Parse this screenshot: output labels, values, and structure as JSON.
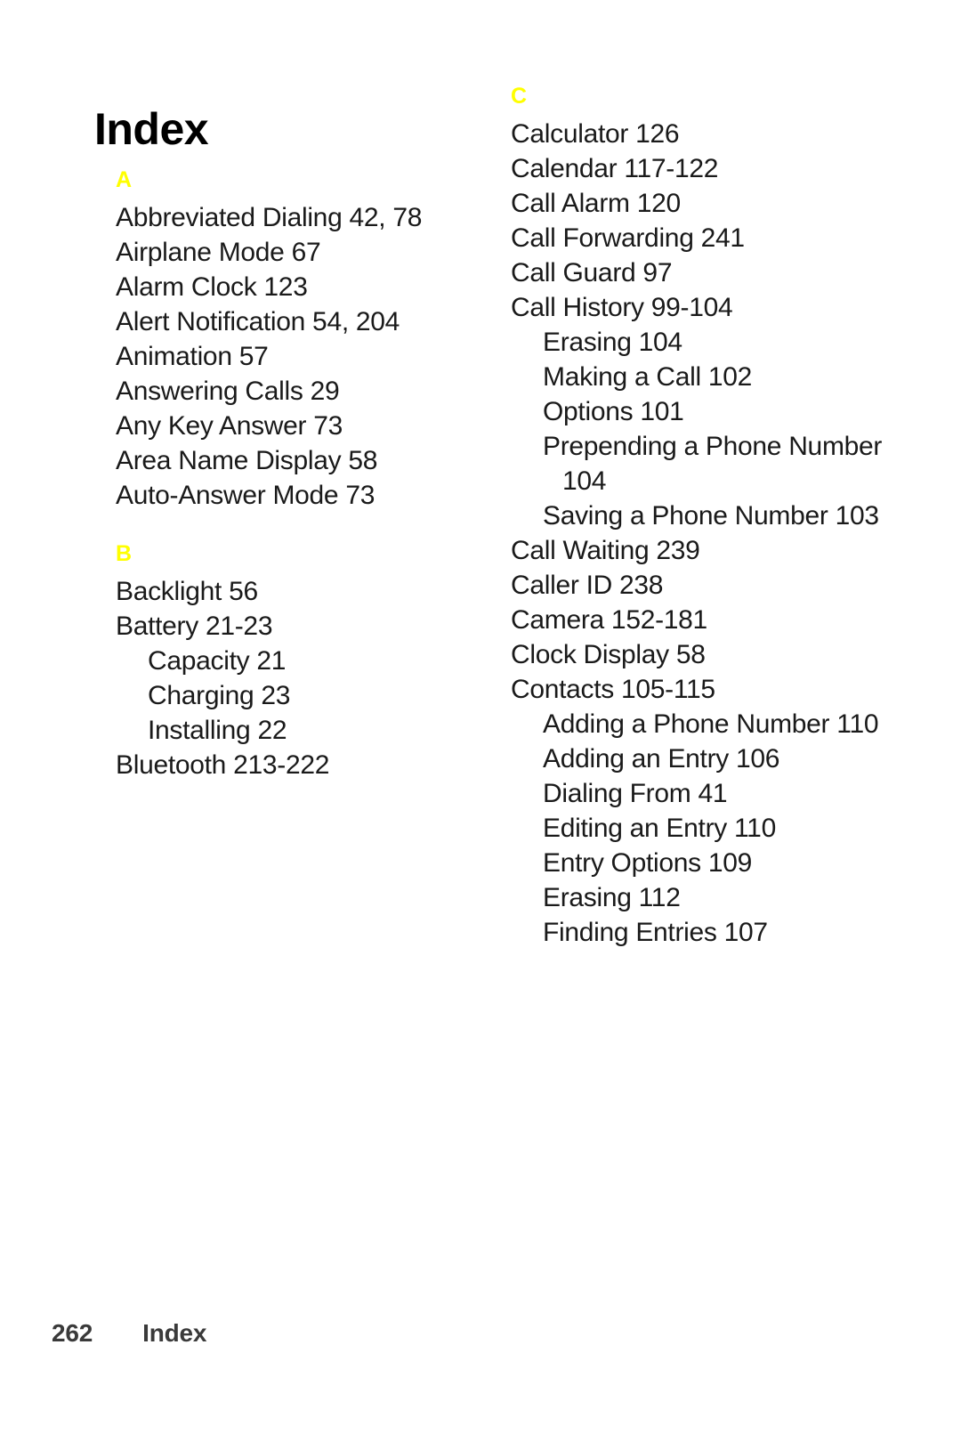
{
  "document": {
    "title": "Index",
    "accent_color": "#ffff00",
    "text_color": "#1a1a1a",
    "footer_color": "#3a3a3a"
  },
  "columns": [
    {
      "name": "left-column",
      "sections": [
        {
          "letter": "A",
          "entries": [
            {
              "text": "Abbreviated Dialing 42, 78",
              "level": 1
            },
            {
              "text": "Airplane Mode 67",
              "level": 1
            },
            {
              "text": "Alarm Clock 123",
              "level": 1
            },
            {
              "text": "Alert Notification 54, 204",
              "level": 1
            },
            {
              "text": "Animation 57",
              "level": 1
            },
            {
              "text": "Answering Calls 29",
              "level": 1
            },
            {
              "text": "Any Key Answer 73",
              "level": 1
            },
            {
              "text": "Area Name Display 58",
              "level": 1
            },
            {
              "text": "Auto-Answer Mode 73",
              "level": 1
            }
          ]
        },
        {
          "letter": "B",
          "entries": [
            {
              "text": "Backlight 56",
              "level": 1
            },
            {
              "text": "Battery 21-23",
              "level": 1
            },
            {
              "text": "Capacity 21",
              "level": 2
            },
            {
              "text": "Charging 23",
              "level": 2
            },
            {
              "text": "Installing 22",
              "level": 2
            },
            {
              "text": "Bluetooth 213-222",
              "level": 1
            }
          ]
        }
      ]
    },
    {
      "name": "right-column",
      "sections": [
        {
          "letter": "C",
          "entries": [
            {
              "text": "Calculator 126",
              "level": 1
            },
            {
              "text": "Calendar 117-122",
              "level": 1
            },
            {
              "text": "Call Alarm 120",
              "level": 1
            },
            {
              "text": "Call Forwarding 241",
              "level": 1
            },
            {
              "text": "Call Guard 97",
              "level": 1
            },
            {
              "text": "Call History 99-104",
              "level": 1
            },
            {
              "text": "Erasing 104",
              "level": 2
            },
            {
              "text": "Making a Call 102",
              "level": 2
            },
            {
              "text": "Options 101",
              "level": 2
            },
            {
              "text": "Prepending a Phone Number 104",
              "level": 2,
              "wrapped": true
            },
            {
              "text": "Saving a Phone Number 103",
              "level": 2,
              "wrapped": true
            },
            {
              "text": "Call Waiting 239",
              "level": 1
            },
            {
              "text": "Caller ID 238",
              "level": 1
            },
            {
              "text": "Camera 152-181",
              "level": 1
            },
            {
              "text": "Clock Display 58",
              "level": 1
            },
            {
              "text": "Contacts 105-115",
              "level": 1
            },
            {
              "text": "Adding a Phone Number 110",
              "level": 2,
              "wrapped": true
            },
            {
              "text": "Adding an Entry 106",
              "level": 2
            },
            {
              "text": "Dialing From 41",
              "level": 2
            },
            {
              "text": "Editing an Entry 110",
              "level": 2
            },
            {
              "text": "Entry Options 109",
              "level": 2
            },
            {
              "text": "Erasing 112",
              "level": 2
            },
            {
              "text": "Finding Entries 107",
              "level": 2
            }
          ]
        }
      ]
    }
  ],
  "footer": {
    "page_number": "262",
    "label": "Index"
  }
}
